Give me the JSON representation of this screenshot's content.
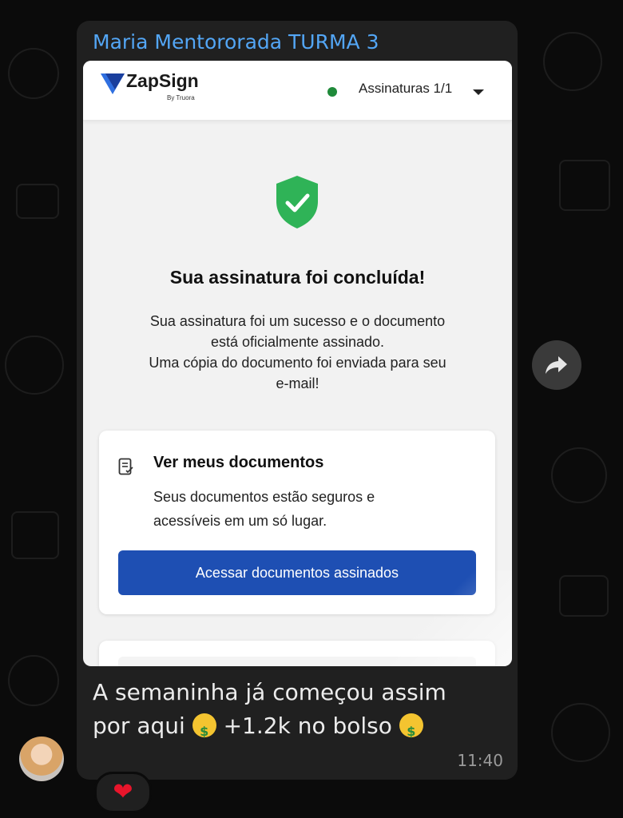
{
  "chat": {
    "sender_name": "Maria Mentororada TURMA 3",
    "caption_line1": "A semaninha já começou assim",
    "caption_line2_a": "por aqui",
    "caption_line2_b": "+1.2k no bolso",
    "caption_emoji": "money-mouth-face",
    "timestamp": "11:40",
    "reaction": "❤",
    "forward_icon": "forward-arrow-icon"
  },
  "zapsign": {
    "logo_text": "ZapSign",
    "logo_sub": "By Truora",
    "signatures_label": "Assinaturas 1/1",
    "status_color": "#1f8a3a",
    "success_title": "Sua assinatura foi concluída!",
    "success_lines": [
      "Sua assinatura foi um sucesso e o documento",
      "está oficialmente assinado.",
      "Uma cópia do documento foi enviada para seu",
      "e-mail!"
    ],
    "docs_card": {
      "title": "Ver meus documentos",
      "desc_line1": "Seus documentos estão seguros e",
      "desc_line2": "acessíveis em um só lugar.",
      "button_label": "Acessar documentos assinados"
    },
    "colors": {
      "button": "#1e4fb3",
      "shield": "#2fb357",
      "sender": "#53a6f5"
    }
  }
}
